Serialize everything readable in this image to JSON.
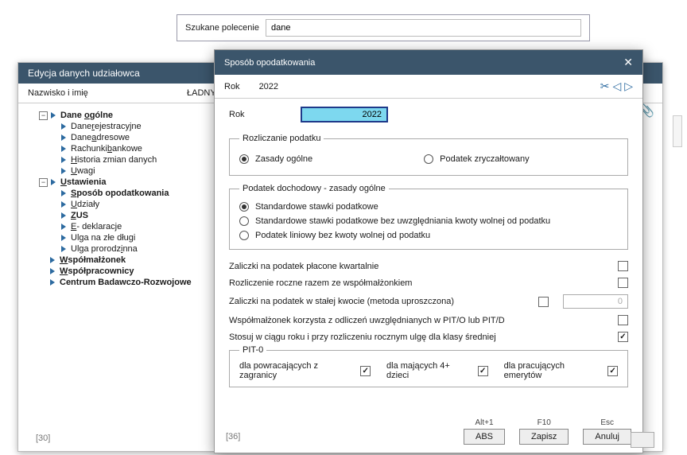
{
  "search": {
    "label": "Szukane polecenie",
    "value": "dane"
  },
  "win1": {
    "title": "Edycja danych udziałowca",
    "sub_label": "Nazwisko i imię",
    "sub_value": "ŁADNY Udział",
    "footer": "[30]",
    "tree": {
      "n1": "Dane ogólne",
      "n1u": "o",
      "n1_1": "Dane rejestracyjne",
      "n1_1u": "r",
      "n1_2": "Dane adresowe",
      "n1_2u": "a",
      "n1_3": "Rachunki bankowe",
      "n1_3u": "b",
      "n1_4": "Historia zmian danych",
      "n1_4u": "H",
      "n1_5": "Uwagi",
      "n1_5u": "U",
      "n2": "Ustawienia",
      "n2u": "U",
      "n2_1": "Sposób opodatkowania",
      "n2_1u": "S",
      "n2_2": "Udziały",
      "n2_2u": "U",
      "n2_3": "ZUS",
      "n2_3u": "Z",
      "n2_4": "E - deklaracje",
      "n2_4u": "E",
      "n2_5": "Ulga na złe długi",
      "n2_6": "Ulga prorodzinna",
      "n2_6u": "i",
      "n3": "Współmałżonek",
      "n3u": "W",
      "n4": "Współpracownicy",
      "n4u": "W",
      "n5": "Centrum Badawczo-Rozwojowe"
    }
  },
  "win2": {
    "title": "Sposób opodatkowania",
    "top_label": "Rok",
    "top_year": "2022",
    "rok_label": "Rok",
    "rok_value": "2022",
    "legend1": "Rozliczanie podatku",
    "r1a": "Zasady ogólne",
    "r1b": "Podatek zryczałtowany",
    "legend2": "Podatek dochodowy - zasady ogólne",
    "r2a": "Standardowe stawki podatkowe",
    "r2b": "Standardowe stawki podatkowe bez uwzględniania kwoty wolnej od podatku",
    "r2c": "Podatek liniowy bez kwoty wolnej od podatku",
    "c1": "Zaliczki na podatek płacone kwartalnie",
    "c2": "Rozliczenie roczne razem ze współmałżonkiem",
    "c3": "Zaliczki na podatek w stałej kwocie (metoda uproszczona)",
    "c3v": "0",
    "c4": "Współmałżonek korzysta z odliczeń uwzględnianych w PIT/O lub PIT/D",
    "c5": "Stosuj w ciągu roku i przy rozliczeniu rocznym ulgę dla klasy średniej",
    "legend3": "PIT-0",
    "p1": "dla powracających z zagranicy",
    "p2": "dla mających 4+ dzieci",
    "p3": "dla pracujących emerytów",
    "footer": "[36]",
    "btn1_sc": "Alt+1",
    "btn1": "ABS",
    "btn2_sc": "F10",
    "btn2": "Zapisz",
    "btn3_sc": "Esc",
    "btn3": "Anuluj"
  }
}
